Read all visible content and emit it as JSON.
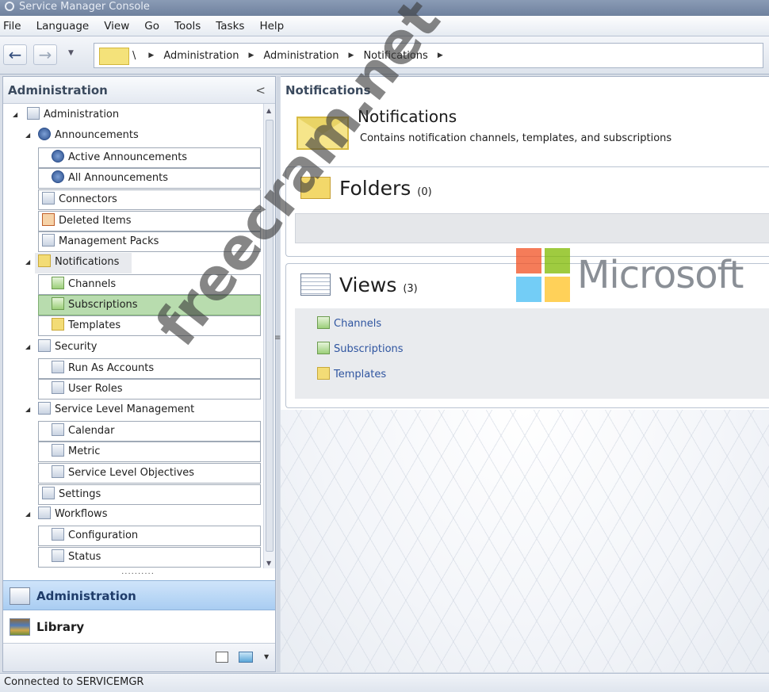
{
  "window": {
    "title": "Service Manager Console"
  },
  "menu": [
    "File",
    "Language",
    "View",
    "Go",
    "Tools",
    "Tasks",
    "Help"
  ],
  "address": {
    "root": "\\",
    "crumbs": [
      "Administration",
      "Administration",
      "Notifications"
    ]
  },
  "left_pane": {
    "header": "Administration",
    "collapse_glyph": "<",
    "tree": [
      {
        "label": "Administration",
        "icon": "admin-icon",
        "expanded": true
      },
      {
        "label": "Announcements",
        "icon": "announcement-icon",
        "expanded": true
      },
      {
        "label": "Active Announcements",
        "icon": "announcement-icon"
      },
      {
        "label": "All Announcements",
        "icon": "announcement-icon"
      },
      {
        "label": "Connectors",
        "icon": "connector-icon"
      },
      {
        "label": "Deleted Items",
        "icon": "deleted-items-icon"
      },
      {
        "label": "Management Packs",
        "icon": "management-pack-icon"
      },
      {
        "label": "Notifications",
        "icon": "folder-icon",
        "expanded": true
      },
      {
        "label": "Channels",
        "icon": "channel-icon"
      },
      {
        "label": "Subscriptions",
        "icon": "subscription-icon",
        "selected": true
      },
      {
        "label": "Templates",
        "icon": "template-icon"
      },
      {
        "label": "Security",
        "icon": "security-icon",
        "expanded": true
      },
      {
        "label": "Run As Accounts",
        "icon": "run-as-icon"
      },
      {
        "label": "User Roles",
        "icon": "user-roles-icon"
      },
      {
        "label": "Service Level Management",
        "icon": "slm-icon",
        "expanded": true
      },
      {
        "label": "Calendar",
        "icon": "calendar-icon"
      },
      {
        "label": "Metric",
        "icon": "metric-icon"
      },
      {
        "label": "Service Level Objectives",
        "icon": "slo-icon"
      },
      {
        "label": "Settings",
        "icon": "settings-icon"
      },
      {
        "label": "Workflows",
        "icon": "workflow-icon",
        "expanded": true
      },
      {
        "label": "Configuration",
        "icon": "workflow-icon"
      },
      {
        "label": "Status",
        "icon": "workflow-icon"
      }
    ],
    "workspaces": [
      {
        "label": "Administration",
        "active": true
      },
      {
        "label": "Library",
        "active": false
      }
    ]
  },
  "content": {
    "pane_title": "Notifications",
    "heading": "Notifications",
    "description": "Contains notification channels, templates, and subscriptions",
    "folders": {
      "title": "Folders",
      "count": "(0)"
    },
    "views": {
      "title": "Views",
      "count": "(3)",
      "items": [
        "Channels",
        "Subscriptions",
        "Templates"
      ]
    }
  },
  "overlay": {
    "watermark": "freecram.net",
    "logo_text": "Microsoft",
    "logo_colors": [
      "#f25022",
      "#7fba00",
      "#00a4ef",
      "#ffb900"
    ]
  },
  "status": "Connected to SERVICEMGR"
}
